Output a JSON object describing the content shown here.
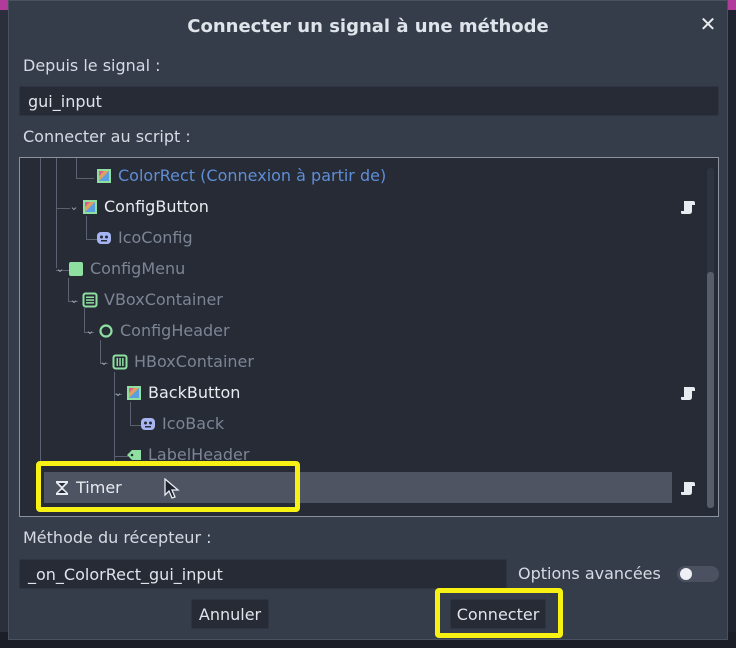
{
  "dialog": {
    "title": "Connecter un signal à une méthode",
    "signal_label": "Depuis le signal :",
    "signal_value": "gui_input",
    "script_label": "Connecter au script :",
    "method_label": "Méthode du récepteur :",
    "method_value": "_on_ColorRect_gui_input",
    "advanced_label": "Options avancées",
    "advanced_enabled": false,
    "cancel_label": "Annuler",
    "connect_label": "Connecter"
  },
  "tree": {
    "nodes": [
      {
        "label": "ColorRect (Connexion à partir de)",
        "icon": "colorrect-icon",
        "style": "blue",
        "has_script": false
      },
      {
        "label": "ConfigButton",
        "icon": "texturebutton-icon",
        "style": "bright",
        "has_script": true
      },
      {
        "label": "IcoConfig",
        "icon": "sprite-icon",
        "style": "dim",
        "has_script": false
      },
      {
        "label": "ConfigMenu",
        "icon": "control-icon",
        "style": "dim",
        "has_script": false
      },
      {
        "label": "VBoxContainer",
        "icon": "vbox-icon",
        "style": "dim",
        "has_script": false
      },
      {
        "label": "ConfigHeader",
        "icon": "circle-node-icon",
        "style": "dim",
        "has_script": false
      },
      {
        "label": "HBoxContainer",
        "icon": "hbox-icon",
        "style": "dim",
        "has_script": false
      },
      {
        "label": "BackButton",
        "icon": "texturebutton-icon",
        "style": "bright",
        "has_script": true
      },
      {
        "label": "IcoBack",
        "icon": "sprite-icon",
        "style": "dim",
        "has_script": false
      },
      {
        "label": "LabelHeader",
        "icon": "label-icon",
        "style": "dim",
        "has_script": false
      },
      {
        "label": "Timer",
        "icon": "timer-icon",
        "style": "bright",
        "has_script": true,
        "selected": true
      }
    ]
  },
  "colors": {
    "dialog_bg": "#363d4a",
    "field_bg": "#262b36",
    "highlight": "#f7f214",
    "blue_text": "#5f8ed6",
    "accent_green": "#8fe0a0"
  }
}
